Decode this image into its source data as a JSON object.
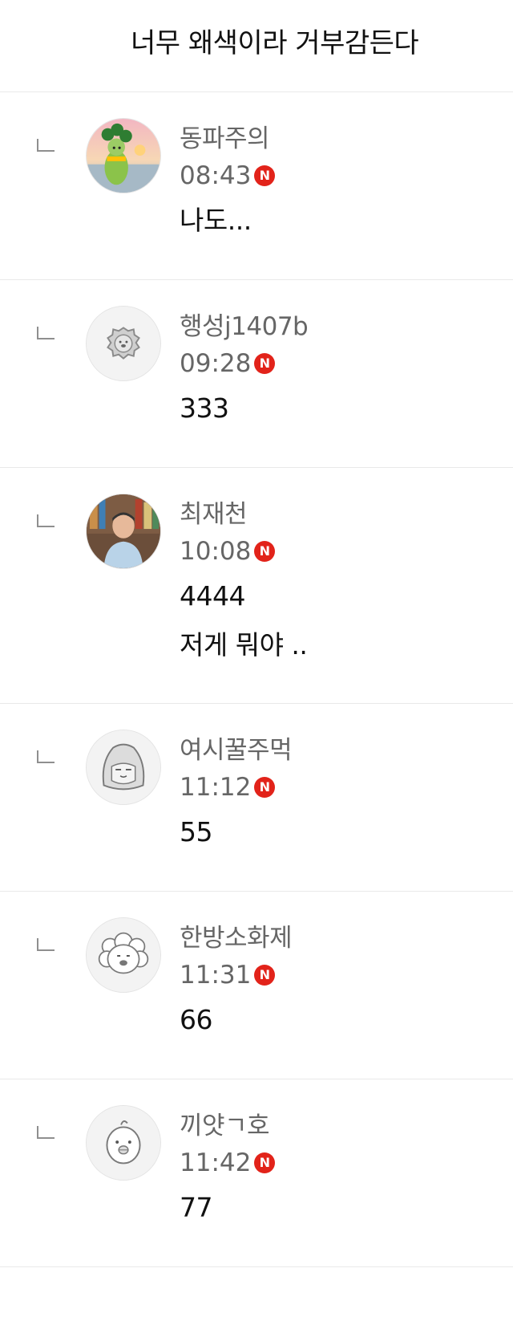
{
  "parent_comment": {
    "text": "너무 왜색이라 거부감든다"
  },
  "replies": [
    {
      "nickname": "동파주의",
      "time": "08:43",
      "badge": "N",
      "avatar": "cartoon-character-photo",
      "lines": [
        "나도..."
      ]
    },
    {
      "nickname": "행성j1407b",
      "time": "09:28",
      "badge": "N",
      "avatar": "default-lion-icon",
      "lines": [
        "333"
      ]
    },
    {
      "nickname": "최재천",
      "time": "10:08",
      "badge": "N",
      "avatar": "person-photo",
      "lines": [
        "4444",
        "저게 뭐야 .."
      ]
    },
    {
      "nickname": "여시꿀주먹",
      "time": "11:12",
      "badge": "N",
      "avatar": "default-fox-icon",
      "lines": [
        "55"
      ]
    },
    {
      "nickname": "한방소화제",
      "time": "11:31",
      "badge": "N",
      "avatar": "default-poodle-icon",
      "lines": [
        "66"
      ]
    },
    {
      "nickname": "끼얏ㄱ호",
      "time": "11:42",
      "badge": "N",
      "avatar": "default-chick-icon",
      "lines": [
        "77"
      ]
    }
  ],
  "colors": {
    "new_badge": "#e2231a",
    "nickname": "#666666",
    "divider": "#e9e9e9"
  }
}
